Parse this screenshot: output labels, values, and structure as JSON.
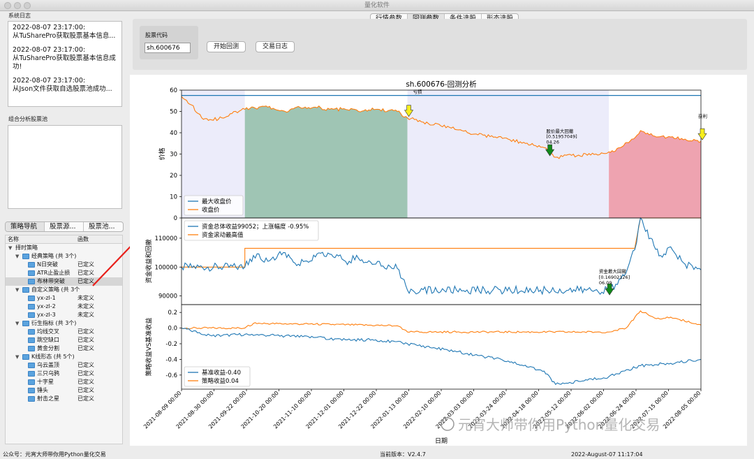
{
  "window": {
    "title": "量化软件"
  },
  "system_log": {
    "label": "系统日志",
    "entries": [
      {
        "time": "2022-08-07 23:17:00:",
        "message": "从TuSharePro获取股票基本信息..."
      },
      {
        "time": "2022-08-07 23:17:00:",
        "message": "从TuSharePro获取股票基本信息成功!"
      },
      {
        "time": "2022-08-07 23:17:00:",
        "message": "从Json文件获取自选股票池成功..."
      }
    ]
  },
  "pool": {
    "label": "组合分析股票池"
  },
  "nav_tabs": [
    "策略导航",
    "股票源...",
    "股票池..."
  ],
  "tree": {
    "col_name": "名称",
    "col_fn": "函数",
    "root": "择时策略",
    "groups": [
      {
        "label": "经典策略 (共 3个)",
        "items": [
          {
            "name": "N日突破",
            "status": "已定义"
          },
          {
            "name": "ATR止盈止损",
            "status": "已定义"
          },
          {
            "name": "布林带突破",
            "status": "已定义"
          }
        ]
      },
      {
        "label": "自定义策略 (共 3个",
        "items": [
          {
            "name": "yx-zl-1",
            "status": "未定义"
          },
          {
            "name": "yx-zl-2",
            "status": "未定义"
          },
          {
            "name": "yx-zl-3",
            "status": "未定义"
          }
        ]
      },
      {
        "label": "衍生指标 (共 3个)",
        "items": [
          {
            "name": "均线交叉",
            "status": "已定义"
          },
          {
            "name": "跳空缺口",
            "status": "已定义"
          },
          {
            "name": "黄金分割",
            "status": "已定义"
          }
        ]
      },
      {
        "label": "K线形态 (共 5个)",
        "items": [
          {
            "name": "乌云盖顶",
            "status": "已定义"
          },
          {
            "name": "三只乌鸦",
            "status": "已定义"
          },
          {
            "name": "十字星",
            "status": "已定义"
          },
          {
            "name": "锤头",
            "status": "已定义"
          },
          {
            "name": "射击之星",
            "status": "已定义"
          }
        ]
      }
    ]
  },
  "top_tabs": [
    "行情参数",
    "回测参数",
    "条件选股",
    "形态选股"
  ],
  "controls": {
    "stock_code_label": "股票代码",
    "stock_code_value": "sh.600676",
    "start_button": "开始回测",
    "log_button": "交易日志"
  },
  "colors": {
    "blue": "#1f77b4",
    "orange": "#ff7f0e",
    "green_fill": "#9fc5b4",
    "red_fill": "#eea3b0",
    "lavender": "#ececfa",
    "arrow_red": "#e8201b"
  },
  "chart_data": {
    "type": "line",
    "title": "sh.600676-回测分析",
    "xlabel": "日期",
    "x_ticks": [
      "2021-08-09 00:00",
      "2021-08-30 00:00",
      "2021-09-22 00:00",
      "2021-10-20 00:00",
      "2021-11-10 00:00",
      "2021-12-01 00:00",
      "2021-12-22 00:00",
      "2022-01-13 00:00",
      "2022-02-10 00:00",
      "2022-03-03 00:00",
      "2022-03-24 00:00",
      "2022-04-18 00:00",
      "2022-05-12 00:00",
      "2022-06-02 00:00",
      "2022-06-24 00:00",
      "2022-07-15 00:00",
      "2022-08-05 00:00"
    ],
    "price_panel": {
      "ylabel": "价格",
      "ylim": [
        0,
        60
      ],
      "yticks": [
        0,
        10,
        20,
        30,
        40,
        50,
        60
      ],
      "max_close_value": 57.5,
      "legend": [
        "最大收盘价",
        "收盘价"
      ],
      "close_anchor_points": [
        [
          "2021-08-09",
          57
        ],
        [
          "2021-08-16",
          53
        ],
        [
          "2021-08-23",
          47
        ],
        [
          "2021-08-30",
          46
        ],
        [
          "2021-09-06",
          47
        ],
        [
          "2021-09-13",
          49
        ],
        [
          "2021-09-22",
          51
        ],
        [
          "2021-10-08",
          52
        ],
        [
          "2021-10-20",
          50
        ],
        [
          "2021-10-28",
          52
        ],
        [
          "2021-11-10",
          52
        ],
        [
          "2021-11-20",
          51
        ],
        [
          "2021-12-01",
          51
        ],
        [
          "2021-12-10",
          50
        ],
        [
          "2021-12-22",
          51
        ],
        [
          "2022-01-06",
          50
        ],
        [
          "2022-01-13",
          47
        ],
        [
          "2022-01-24",
          45
        ],
        [
          "2022-02-10",
          43
        ],
        [
          "2022-02-20",
          41
        ],
        [
          "2022-03-03",
          39
        ],
        [
          "2022-03-15",
          38
        ],
        [
          "2022-03-24",
          37
        ],
        [
          "2022-04-05",
          35
        ],
        [
          "2022-04-18",
          33
        ],
        [
          "2022-04-26",
          28.5
        ],
        [
          "2022-05-12",
          29.5
        ],
        [
          "2022-05-24",
          30
        ],
        [
          "2022-06-02",
          31
        ],
        [
          "2022-06-10",
          33
        ],
        [
          "2022-06-18",
          37
        ],
        [
          "2022-06-24",
          41
        ],
        [
          "2022-07-05",
          38
        ],
        [
          "2022-07-15",
          38
        ],
        [
          "2022-07-25",
          37
        ],
        [
          "2022-08-05",
          36
        ]
      ],
      "regions": [
        {
          "from": "2021-08-09",
          "to": "2021-09-22",
          "fill": "lavender"
        },
        {
          "from": "2021-09-22",
          "to": "2022-01-13",
          "fill": "green"
        },
        {
          "from": "2022-01-13",
          "to": "2022-06-02",
          "fill": "lavender"
        },
        {
          "from": "2022-06-02",
          "to": "2022-08-05",
          "fill": "red"
        }
      ],
      "annotations": [
        {
          "text": "亏损",
          "x": "2022-01-13",
          "y": 58.5
        },
        {
          "text": "股价最大回撤",
          "x": "2022-04-18",
          "y": 40
        },
        {
          "text": "[0.51957049]",
          "x": "2022-04-18",
          "y": 37.5
        },
        {
          "text": "04.26",
          "x": "2022-04-18",
          "y": 35
        },
        {
          "text": "获利",
          "x": "2022-08-05",
          "y": 47
        }
      ]
    },
    "equity_panel": {
      "ylabel": "资金收益和回撤",
      "ylim": [
        87000,
        117000
      ],
      "yticks": [
        90000,
        100000,
        110000
      ],
      "legend": [
        "资金总体收益99052；上涨幅度 -0.95%",
        "资金滚动最高值"
      ],
      "equity_anchor_points": [
        [
          "2021-08-09",
          100000
        ],
        [
          "2021-09-22",
          100000
        ],
        [
          "2021-09-28",
          104000
        ],
        [
          "2021-10-08",
          102000
        ],
        [
          "2021-10-20",
          105000
        ],
        [
          "2021-10-28",
          100500
        ],
        [
          "2021-11-10",
          103500
        ],
        [
          "2021-11-20",
          104500
        ],
        [
          "2021-12-01",
          102000
        ],
        [
          "2021-12-10",
          103000
        ],
        [
          "2021-12-22",
          101000
        ],
        [
          "2022-01-06",
          99500
        ],
        [
          "2022-01-13",
          92000
        ],
        [
          "2022-06-02",
          92000
        ],
        [
          "2022-06-08",
          94000
        ],
        [
          "2022-06-14",
          98000
        ],
        [
          "2022-06-20",
          106000
        ],
        [
          "2022-06-24",
          117000
        ],
        [
          "2022-07-01",
          110000
        ],
        [
          "2022-07-08",
          104000
        ],
        [
          "2022-07-15",
          107000
        ],
        [
          "2022-07-25",
          101000
        ],
        [
          "2022-08-05",
          99052
        ]
      ],
      "rolling_max_anchor_points": [
        [
          "2021-08-09",
          100000
        ],
        [
          "2021-09-22",
          100000
        ],
        [
          "2021-09-22",
          106500
        ],
        [
          "2022-06-20",
          106500
        ],
        [
          "2022-06-24",
          117000
        ],
        [
          "2022-08-05",
          117000
        ]
      ],
      "annotations": [
        {
          "text": "资金最大回撤",
          "x": "2022-05-29",
          "y": 98000
        },
        {
          "text": "[0.16902126]",
          "x": "2022-05-29",
          "y": 96000
        },
        {
          "text": "06.09",
          "x": "2022-05-29",
          "y": 94000
        }
      ]
    },
    "return_panel": {
      "ylabel": "策略收益VS基准收益",
      "ylim": [
        -0.78,
        0.3
      ],
      "yticks": [
        -0.6,
        -0.4,
        -0.2,
        0.0,
        0.2
      ],
      "legend": [
        "基准收益-0.40",
        "策略收益0.04"
      ],
      "benchmark_anchor_points": [
        [
          "2021-08-09",
          0
        ],
        [
          "2021-08-30",
          -0.1
        ],
        [
          "2021-09-22",
          -0.08
        ],
        [
          "2021-10-20",
          -0.1
        ],
        [
          "2021-11-10",
          -0.12
        ],
        [
          "2021-12-01",
          -0.15
        ],
        [
          "2021-12-22",
          -0.15
        ],
        [
          "2022-01-13",
          -0.2
        ],
        [
          "2022-02-10",
          -0.28
        ],
        [
          "2022-03-03",
          -0.35
        ],
        [
          "2022-03-24",
          -0.42
        ],
        [
          "2022-04-18",
          -0.55
        ],
        [
          "2022-04-26",
          -0.72
        ],
        [
          "2022-05-12",
          -0.68
        ],
        [
          "2022-06-02",
          -0.62
        ],
        [
          "2022-06-24",
          -0.48
        ],
        [
          "2022-07-15",
          -0.45
        ],
        [
          "2022-08-05",
          -0.4
        ]
      ],
      "strategy_anchor_points": [
        [
          "2021-08-09",
          0
        ],
        [
          "2021-09-22",
          0
        ],
        [
          "2021-09-28",
          0.06
        ],
        [
          "2021-11-10",
          0.05
        ],
        [
          "2022-01-06",
          0.03
        ],
        [
          "2022-01-13",
          -0.05
        ],
        [
          "2022-06-02",
          -0.05
        ],
        [
          "2022-06-14",
          0.0
        ],
        [
          "2022-06-24",
          0.22
        ],
        [
          "2022-07-05",
          0.12
        ],
        [
          "2022-07-15",
          0.14
        ],
        [
          "2022-08-05",
          0.04
        ]
      ]
    }
  },
  "watermark": "元宵大师带你用Python量化交易",
  "status": {
    "left": "公众号：元宵大师带你用Python量化交易",
    "version": "当前版本：V2.4.7",
    "datetime": "2022-August-07 11:17:04"
  }
}
